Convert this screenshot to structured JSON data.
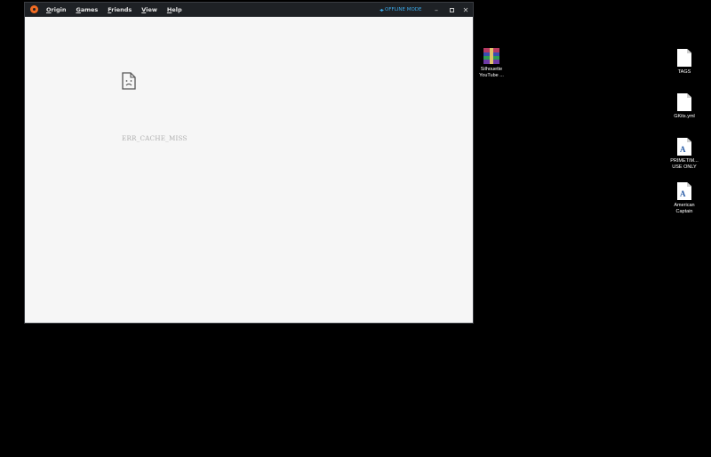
{
  "window": {
    "menu": [
      {
        "mnemonic": "O",
        "rest": "rigin"
      },
      {
        "mnemonic": "G",
        "rest": "ames"
      },
      {
        "mnemonic": "F",
        "rest": "riends"
      },
      {
        "mnemonic": "V",
        "rest": "iew"
      },
      {
        "mnemonic": "H",
        "rest": "elp"
      }
    ],
    "offline_label": "OFFLINE MODE",
    "controls": {
      "minimize": "–",
      "close": "✕"
    },
    "error_code": "ERR_CACHE_MISS"
  },
  "desktop_icons": [
    {
      "label_line1": "Silhouette",
      "label_line2": "YouTube ...",
      "icon": "winrar-archive-icon"
    },
    {
      "label_line1": "TAGS",
      "label_line2": "",
      "icon": "blank-file-icon"
    },
    {
      "label_line1": "GKits.yml",
      "label_line2": "",
      "icon": "blank-file-icon"
    },
    {
      "label_line1": "PRIMETIM...",
      "label_line2": "USE ONLY",
      "icon": "font-file-icon"
    },
    {
      "label_line1": "American",
      "label_line2": "Captain",
      "icon": "font-file-icon"
    }
  ],
  "glyphs": {
    "font_letter": "A"
  },
  "colors": {
    "accent_offline": "#3ba8e6",
    "origin_orange": "#f26c23"
  }
}
